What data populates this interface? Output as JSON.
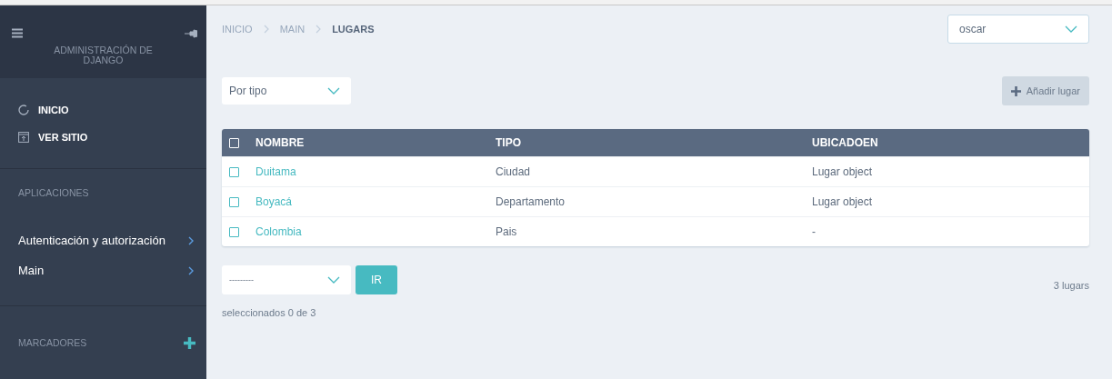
{
  "sidebar": {
    "title": "ADMINISTRACIÓN DE DJANGO",
    "links": [
      {
        "kind": "home",
        "label": "INICIO"
      },
      {
        "kind": "site",
        "label": "VER SITIO"
      }
    ],
    "apps_heading": "APLICACIONES",
    "apps": [
      {
        "label": "Autenticación y autorización"
      },
      {
        "label": "Main"
      }
    ],
    "bookmarks_heading": "MARCADORES"
  },
  "breadcrumbs": [
    "INICIO",
    "MAIN",
    "LUGARS"
  ],
  "user_menu": {
    "value": "oscar"
  },
  "filter": {
    "value": "Por tipo"
  },
  "add_button": "Añadir lugar",
  "table": {
    "select_all_checked": false,
    "columns": [
      "NOMBRE",
      "TIPO",
      "UBICADOEN"
    ],
    "rows": [
      {
        "checked": false,
        "cells": [
          "Duitama",
          "Ciudad",
          "Lugar object"
        ]
      },
      {
        "checked": false,
        "cells": [
          "Boyacá",
          "Departamento",
          "Lugar object"
        ]
      },
      {
        "checked": false,
        "cells": [
          "Colombia",
          "Pais",
          "-"
        ]
      }
    ]
  },
  "action": {
    "value": "---------",
    "button": "IR"
  },
  "selection_count": "seleccionados 0 de 3",
  "total": "3 lugars"
}
